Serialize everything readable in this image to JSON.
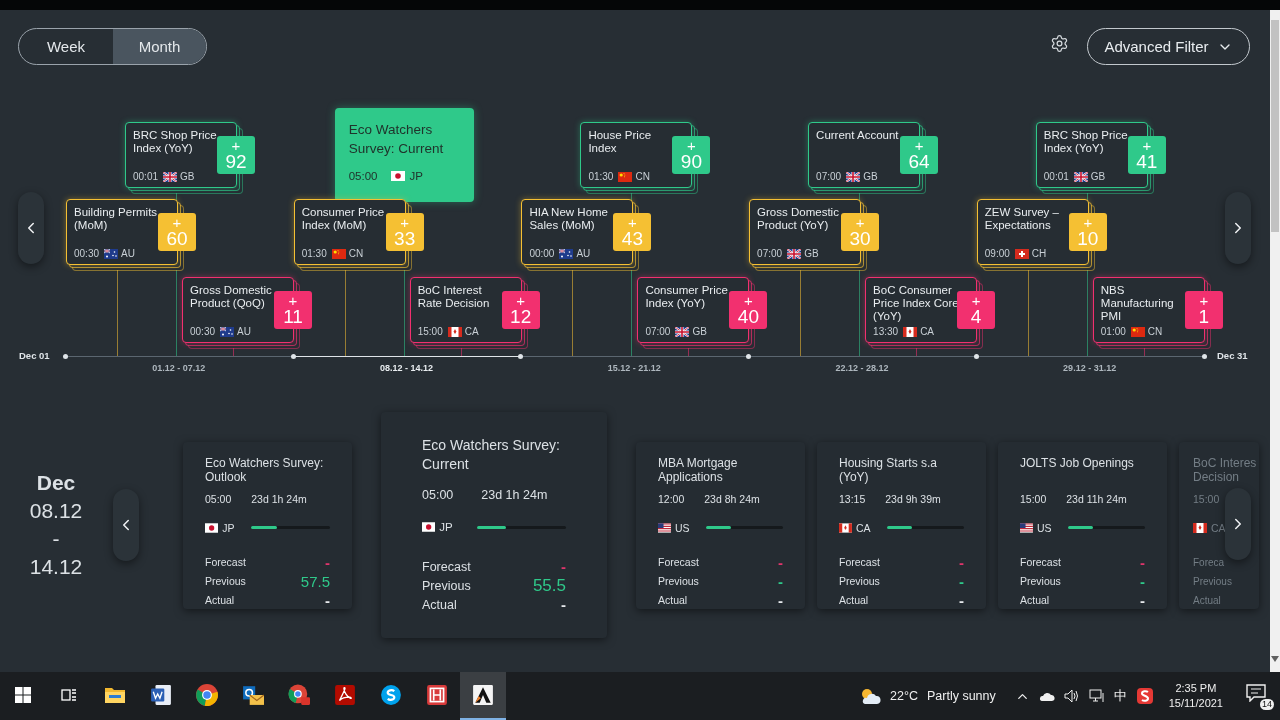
{
  "view_toggle": [
    {
      "label": "Week",
      "selected": false
    },
    {
      "label": "Month",
      "selected": true
    }
  ],
  "advanced_filter": {
    "label": "Advanced Filter"
  },
  "timeline": {
    "start_label": "Dec 01",
    "end_label": "Dec 31",
    "weeks": [
      {
        "range": "01.12 - 07.12",
        "selected": false,
        "events": [
          {
            "kind": "high",
            "title": "BRC Shop Price Index (YoY)",
            "time": "00:01",
            "country": "GB",
            "flag": {
              "kind": "gb"
            },
            "sign": "+",
            "count": "92",
            "selected": false
          },
          {
            "kind": "medium",
            "title": "Building Permits (MoM)",
            "time": "00:30",
            "country": "AU",
            "flag": {
              "kind": "au"
            },
            "sign": "+",
            "count": "60",
            "selected": false
          },
          {
            "kind": "low",
            "title": "Gross Domestic Product (QoQ)",
            "time": "00:30",
            "country": "AU",
            "flag": {
              "kind": "au"
            },
            "sign": "+",
            "count": "11",
            "selected": false
          }
        ]
      },
      {
        "range": "08.12 - 14.12",
        "selected": true,
        "events": [
          {
            "kind": "high",
            "title": "Eco Watchers Survey: Current",
            "time": "05:00",
            "country": "JP",
            "flag": {
              "kind": "jp"
            },
            "selected": true
          },
          {
            "kind": "medium",
            "title": "Consumer Price Index (MoM)",
            "time": "01:30",
            "country": "CN",
            "flag": {
              "kind": "cn"
            },
            "sign": "+",
            "count": "33",
            "selected": false
          },
          {
            "kind": "low",
            "title": "BoC Interest Rate Decision",
            "time": "15:00",
            "country": "CA",
            "flag": {
              "kind": "ca"
            },
            "sign": "+",
            "count": "12",
            "selected": false
          }
        ]
      },
      {
        "range": "15.12 - 21.12",
        "selected": false,
        "events": [
          {
            "kind": "high",
            "title": "House Price Index",
            "time": "01:30",
            "country": "CN",
            "flag": {
              "kind": "cn"
            },
            "sign": "+",
            "count": "90",
            "selected": false
          },
          {
            "kind": "medium",
            "title": "HIA New Home Sales (MoM)",
            "time": "00:00",
            "country": "AU",
            "flag": {
              "kind": "au"
            },
            "sign": "+",
            "count": "43",
            "selected": false
          },
          {
            "kind": "low",
            "title": "Consumer Price Index (YoY)",
            "time": "07:00",
            "country": "GB",
            "flag": {
              "kind": "gb"
            },
            "sign": "+",
            "count": "40",
            "selected": false
          }
        ]
      },
      {
        "range": "22.12 - 28.12",
        "selected": false,
        "events": [
          {
            "kind": "high",
            "title": "Current Account",
            "time": "07:00",
            "country": "GB",
            "flag": {
              "kind": "gb"
            },
            "sign": "+",
            "count": "64",
            "selected": false
          },
          {
            "kind": "medium",
            "title": "Gross Domestic Product (YoY)",
            "time": "07:00",
            "country": "GB",
            "flag": {
              "kind": "gb"
            },
            "sign": "+",
            "count": "30",
            "selected": false
          },
          {
            "kind": "low",
            "title": "BoC Consumer Price Index Core (YoY)",
            "time": "13:30",
            "country": "CA",
            "flag": {
              "kind": "ca"
            },
            "sign": "+",
            "count": "4",
            "selected": false
          }
        ]
      },
      {
        "range": "29.12 - 31.12",
        "selected": false,
        "events": [
          {
            "kind": "high",
            "title": "BRC Shop Price Index (YoY)",
            "time": "00:01",
            "country": "GB",
            "flag": {
              "kind": "gb"
            },
            "sign": "+",
            "count": "41",
            "selected": false
          },
          {
            "kind": "medium",
            "title": "ZEW Survey – Expectations",
            "time": "09:00",
            "country": "CH",
            "flag": {
              "kind": "ch"
            },
            "sign": "+",
            "count": "10",
            "selected": false
          },
          {
            "kind": "low",
            "title": "NBS Manufacturing PMI",
            "time": "01:00",
            "country": "CN",
            "flag": {
              "kind": "cn"
            },
            "sign": "+",
            "count": "1",
            "selected": false
          }
        ]
      }
    ]
  },
  "period": {
    "month": "Dec",
    "start": "08.12",
    "separator": "-",
    "end": "14.12"
  },
  "event_cards": [
    {
      "title": "Eco Watchers Survey: Outlook",
      "time": "05:00",
      "countdown": "23d 1h 24m",
      "country": "JP",
      "flag": {
        "kind": "jp"
      },
      "level": 0.33,
      "selected": false,
      "stats": [
        {
          "label": "Forecast",
          "value": "-",
          "color": "#e0356c"
        },
        {
          "label": "Previous",
          "value": "57.5",
          "color": "#2fc98a"
        },
        {
          "label": "Actual",
          "value": "-",
          "color": "#e6e9ec"
        }
      ]
    },
    {
      "title": "Eco Watchers Survey: Current",
      "time": "05:00",
      "countdown": "23d 1h 24m",
      "country": "JP",
      "flag": {
        "kind": "jp"
      },
      "level": 0.33,
      "selected": true,
      "stats": [
        {
          "label": "Forecast",
          "value": "-",
          "color": "#e0356c"
        },
        {
          "label": "Previous",
          "value": "55.5",
          "color": "#2fc98a"
        },
        {
          "label": "Actual",
          "value": "-",
          "color": "#e6e9ec"
        }
      ]
    },
    {
      "title": "MBA Mortgage Applications",
      "time": "12:00",
      "countdown": "23d 8h 24m",
      "country": "US",
      "flag": {
        "kind": "us"
      },
      "level": 0.33,
      "selected": false,
      "stats": [
        {
          "label": "Forecast",
          "value": "-",
          "color": "#e0356c"
        },
        {
          "label": "Previous",
          "value": "-",
          "color": "#2fc98a"
        },
        {
          "label": "Actual",
          "value": "-",
          "color": "#e6e9ec"
        }
      ]
    },
    {
      "title": "Housing Starts s.a (YoY)",
      "time": "13:15",
      "countdown": "23d 9h 39m",
      "country": "CA",
      "flag": {
        "kind": "ca"
      },
      "level": 0.33,
      "selected": false,
      "stats": [
        {
          "label": "Forecast",
          "value": "-",
          "color": "#e0356c"
        },
        {
          "label": "Previous",
          "value": "-",
          "color": "#2fc98a"
        },
        {
          "label": "Actual",
          "value": "-",
          "color": "#e6e9ec"
        }
      ]
    },
    {
      "title": "JOLTS Job Openings",
      "time": "15:00",
      "countdown": "23d 11h 24m",
      "country": "US",
      "flag": {
        "kind": "us"
      },
      "level": 0.33,
      "selected": false,
      "stats": [
        {
          "label": "Forecast",
          "value": "-",
          "color": "#e0356c"
        },
        {
          "label": "Previous",
          "value": "-",
          "color": "#2fc98a"
        },
        {
          "label": "Actual",
          "value": "-",
          "color": "#e6e9ec"
        }
      ]
    },
    {
      "title": "BoC Interes Decision",
      "time": "15:00",
      "country": "CA",
      "flag": {
        "kind": "ca"
      },
      "selected": false,
      "kind": "partial",
      "stats": [
        {
          "label": "Foreca"
        },
        {
          "label": "Previous"
        },
        {
          "label": "Actual"
        }
      ]
    }
  ],
  "taskbar": {
    "apps": [
      {
        "kind": "windows",
        "selected": false
      },
      {
        "kind": "taskview",
        "selected": false
      },
      {
        "kind": "folder",
        "selected": false
      },
      {
        "kind": "document",
        "selected": false
      },
      {
        "kind": "browser",
        "selected": false
      },
      {
        "kind": "mail",
        "selected": false
      },
      {
        "kind": "browser2",
        "selected": false
      },
      {
        "kind": "pdf",
        "selected": false
      },
      {
        "kind": "chat",
        "selected": false
      },
      {
        "kind": "frame",
        "selected": false
      },
      {
        "kind": "triangle",
        "selected": true
      }
    ],
    "temperature": "22°C",
    "weather": "Partly sunny",
    "input_method": "中",
    "time": "2:35 PM",
    "date": "15/11/2021",
    "notifications": "14"
  }
}
